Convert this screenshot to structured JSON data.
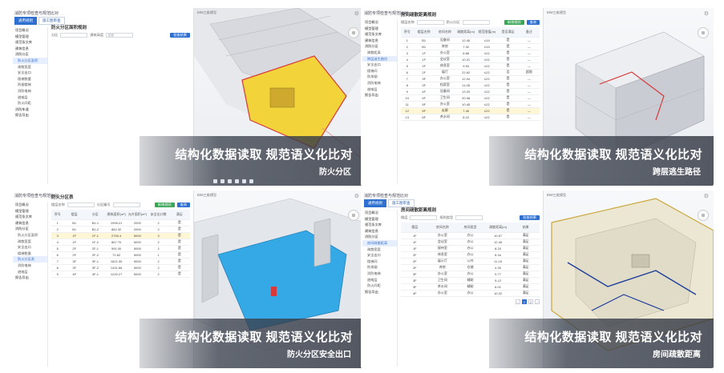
{
  "panels": [
    {
      "app_title": "消防专项检查与规范比对",
      "tabs": [
        "通用规则",
        "施工图审查"
      ],
      "sidebar": [
        "项目概况",
        "模型管理",
        "规范条文库",
        "建筑信息",
        "消防分区",
        "防火分区面积",
        "疏散宽度",
        "安全出口",
        "楼梯数量",
        "防烟楼梯",
        "消防电梯",
        "避难层",
        "防火间距",
        "消防车道",
        "报告导出"
      ],
      "content_title": "防火分区面积规则",
      "filter_label_1": "分区",
      "filter_label_2": "建筑高度",
      "filter_value_2": "全部",
      "query_button": "检查结果",
      "viewer_title": "BIM三维模型",
      "caption_main": "结构化数据读取  规范语义化比对",
      "caption_sub": "防火分区"
    },
    {
      "app_title": "消防专项检查与规范比对",
      "sidebar": [
        "项目概况",
        "模型管理",
        "规范条文库",
        "建筑信息",
        "消防分区",
        "疏散距离",
        "跨层逃生路径",
        "安全出口",
        "楼梯间",
        "防排烟",
        "消防电梯",
        "避难层",
        "报告导出"
      ],
      "content_title": "房间疏散距离规则",
      "filter_label_1": "楼层名称",
      "filter_label_2": "防火分区",
      "add_button": "新增规则",
      "query_button": "查询",
      "headers": [
        "序号",
        "楼层名称",
        "房间名称",
        "疏散距离(m)",
        "规范限值(m)",
        "是否满足",
        "备注"
      ],
      "rows": [
        [
          "1",
          "B1",
          "设备间",
          "12.45",
          "≤15",
          "是",
          "—"
        ],
        [
          "2",
          "B1",
          "库房",
          "7.32",
          "≤15",
          "是",
          "—"
        ],
        [
          "3",
          "1F",
          "办公室",
          "8.88",
          "≤22",
          "是",
          "—"
        ],
        [
          "4",
          "1F",
          "会议室",
          "10.21",
          "≤22",
          "是",
          "—"
        ],
        [
          "5",
          "2F",
          "休息室",
          "9.53",
          "≤22",
          "是",
          "—"
        ],
        [
          "6",
          "2F",
          "展厅",
          "22.62",
          "≤22",
          "否",
          "超限"
        ],
        [
          "7",
          "3F",
          "办公室",
          "12.04",
          "≤22",
          "是",
          "—"
        ],
        [
          "8",
          "3F",
          "档案室",
          "11.08",
          "≤22",
          "是",
          "—"
        ],
        [
          "9",
          "4F",
          "设备间",
          "13.20",
          "≤22",
          "是",
          "—"
        ],
        [
          "10",
          "4F",
          "卫生间",
          "20.08",
          "≤22",
          "是",
          "—"
        ],
        [
          "11",
          "5F",
          "办公室",
          "10.45",
          "≤22",
          "是",
          "—"
        ],
        [
          "12",
          "5F",
          "走廊",
          "7.46",
          "≤22",
          "是",
          "—"
        ],
        [
          "13",
          "6F",
          "茶水间",
          "8.22",
          "≤22",
          "是",
          "—"
        ]
      ],
      "viewer_title": "BIM三维模型",
      "caption_main": "结构化数据读取  规范语义化比对",
      "caption_sub": "跨层逃生路径"
    },
    {
      "app_title": "消防专项检查与规范比对",
      "sidebar": [
        "项目概况",
        "模型管理",
        "规范条文库",
        "建筑信息",
        "消防分区",
        "防火分区面积",
        "疏散宽度",
        "安全出口",
        "楼梯数量",
        "防火分区表",
        "消防电梯",
        "避难层",
        "报告导出"
      ],
      "content_title": "防火分区表",
      "filter_label_1": "楼层名称",
      "filter_label_2": "分区编号",
      "add_button": "新增规则",
      "query_button": "查询",
      "headers": [
        "序号",
        "楼层",
        "分区",
        "建筑面积(m²)",
        "允许面积(m²)",
        "安全出口数",
        "满足"
      ],
      "rows": [
        [
          "1",
          "B1",
          "B1-1",
          "1995.21",
          "2000",
          "2",
          "是"
        ],
        [
          "2",
          "B1",
          "B1-2",
          "862.32",
          "2000",
          "2",
          "是"
        ],
        [
          "3",
          "1F",
          "1F-1",
          "2750.4",
          "5000",
          "3",
          "是"
        ],
        [
          "4",
          "1F",
          "1F-2",
          "867.70",
          "5000",
          "2",
          "是"
        ],
        [
          "5",
          "2F",
          "2F-1",
          "591.00",
          "5000",
          "2",
          "是"
        ],
        [
          "6",
          "2F",
          "2F-2",
          "72.62",
          "5000",
          "1",
          "是"
        ],
        [
          "7",
          "3F",
          "3F-1",
          "1621.35",
          "5000",
          "2",
          "是"
        ],
        [
          "8",
          "3F",
          "3F-2",
          "1431.68",
          "5000",
          "2",
          "是"
        ],
        [
          "9",
          "4F",
          "4F-1",
          "1220.27",
          "5000",
          "2",
          "是"
        ]
      ],
      "viewer_title": "BIM三维模型",
      "caption_main": "结构化数据读取  规范语义化比对",
      "caption_sub": "防火分区安全出口"
    },
    {
      "app_title": "消防专项检查与规范比对",
      "tabs": [
        "通用规则",
        "施工图审查"
      ],
      "sidebar": [
        "项目概况",
        "模型管理",
        "规范条文库",
        "建筑信息",
        "消防分区",
        "房间疏散距离",
        "疏散宽度",
        "安全出口",
        "楼梯间",
        "防排烟",
        "消防电梯",
        "避难层",
        "防火间距",
        "报告导出"
      ],
      "content_title": "房间疏散距离规则",
      "filter_label_1": "楼层",
      "filter_label_2": "规则类型",
      "query_button": "检查结果",
      "headers": [
        "楼层",
        "房间名称",
        "房间类型",
        "疏散距离(m)",
        "结果"
      ],
      "rows": [
        [
          "1F",
          "办公室",
          "办公",
          "10.67",
          "满足"
        ],
        [
          "1F",
          "会议室",
          "办公",
          "12.45",
          "满足"
        ],
        [
          "1F",
          "接待室",
          "办公",
          "8.20",
          "满足"
        ],
        [
          "2F",
          "休息室",
          "办公",
          "8.34",
          "满足"
        ],
        [
          "2F",
          "展示厅",
          "公共",
          "11.15",
          "满足"
        ],
        [
          "2F",
          "库房",
          "仓储",
          "4.30",
          "满足"
        ],
        [
          "3F",
          "办公室",
          "办公",
          "9.77",
          "满足"
        ],
        [
          "3F",
          "卫生间",
          "辅助",
          "5.12",
          "满足"
        ],
        [
          "3F",
          "茶水间",
          "辅助",
          "6.01",
          "满足"
        ],
        [
          "4F",
          "办公室",
          "办公",
          "10.02",
          "满足"
        ]
      ],
      "viewer_title": "BIM三维模型",
      "caption_main": "结构化数据读取  规范语义化比对",
      "caption_sub": "房间疏散距离"
    }
  ],
  "colors": {
    "accent": "#2f6fd0",
    "success": "#3aa757",
    "zone_fill": "#f2d33a",
    "zone_edge": "#d63a3a",
    "area_fill": "#35a9e6",
    "route": "#1e3e9a"
  }
}
